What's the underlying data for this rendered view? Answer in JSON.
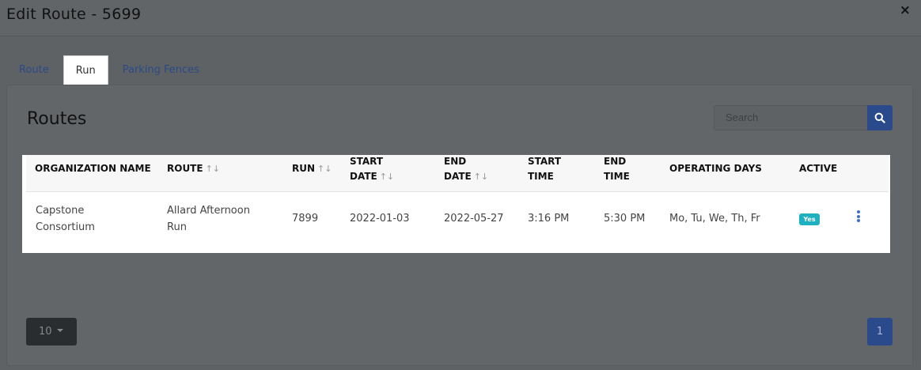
{
  "modal": {
    "title": "Edit Route - 5699",
    "close_glyph": "×"
  },
  "tabs": [
    {
      "label": "Route"
    },
    {
      "label": "Run"
    },
    {
      "label": "Parking Fences"
    }
  ],
  "active_tab": "Run",
  "panel": {
    "title": "Routes",
    "search_placeholder": "Search"
  },
  "table": {
    "headers": {
      "org": "ORGANIZATION NAME",
      "route": "ROUTE",
      "run": "RUN",
      "start_date_1": "START",
      "start_date_2": "DATE",
      "end_date_1": "END",
      "end_date_2": "DATE",
      "start_time_1": "START",
      "start_time_2": "TIME",
      "end_time_1": "END",
      "end_time_2": "TIME",
      "days": "OPERATING DAYS",
      "active": "ACTIVE"
    },
    "sort_glyph": "↑↓",
    "rows": [
      {
        "org_1": "Capstone",
        "org_2": "Consortium",
        "route_1": "Allard Afternoon",
        "route_2": "Run",
        "run": "7899",
        "start_date": "2022-01-03",
        "end_date": "2022-05-27",
        "start_time": "3:16 PM",
        "end_time": "5:30 PM",
        "days": "Mo, Tu, We, Th, Fr",
        "active": "Yes"
      }
    ]
  },
  "footer": {
    "page_size": "10",
    "current_page": "1"
  },
  "colors": {
    "overlay": "#5f6265",
    "primary": "#2b4a8c",
    "badge": "#20b1c0",
    "kebab": "#3a6fd8"
  },
  "icons": {
    "search": "search-icon",
    "close": "close-icon",
    "menu": "kebab-menu-icon",
    "caret": "caret-down-icon"
  }
}
